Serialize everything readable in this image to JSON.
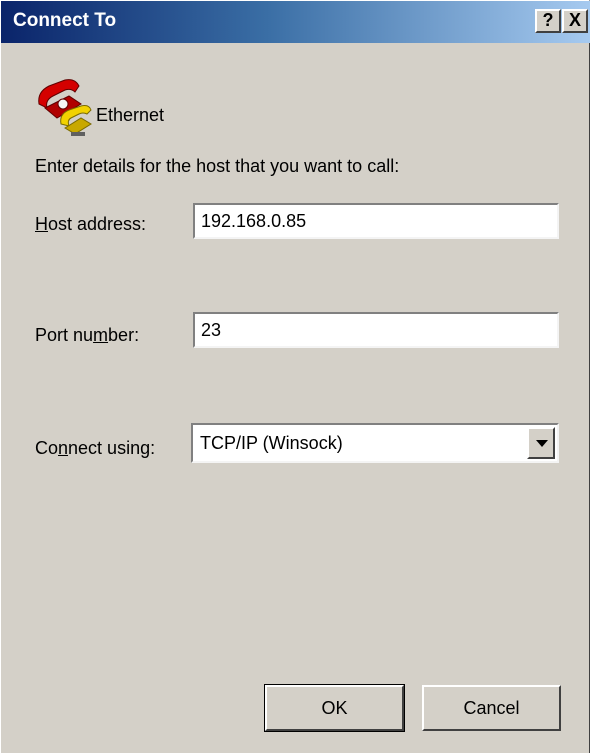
{
  "window": {
    "title": "Connect To",
    "help_button": "?",
    "close_button": "X"
  },
  "connection": {
    "name": "Ethernet",
    "icon": "telephone-icon"
  },
  "instruction": "Enter details for the host that you want to call:",
  "host": {
    "label_pre": "",
    "label_key": "H",
    "label_post": "ost address:",
    "value": "192.168.0.85"
  },
  "port": {
    "label_pre": "Port nu",
    "label_key": "m",
    "label_post": "ber:",
    "value": "23"
  },
  "connect_using": {
    "label_pre": "Co",
    "label_key": "n",
    "label_post": "nect using:",
    "selected": "TCP/IP (Winsock)"
  },
  "buttons": {
    "ok": "OK",
    "cancel": "Cancel"
  },
  "colors": {
    "titlebar_start": "#0a246a",
    "titlebar_end": "#a6caf0",
    "dialog_face": "#d4d0c8",
    "phone_red": "#d40000",
    "phone_yellow": "#f2d200"
  }
}
